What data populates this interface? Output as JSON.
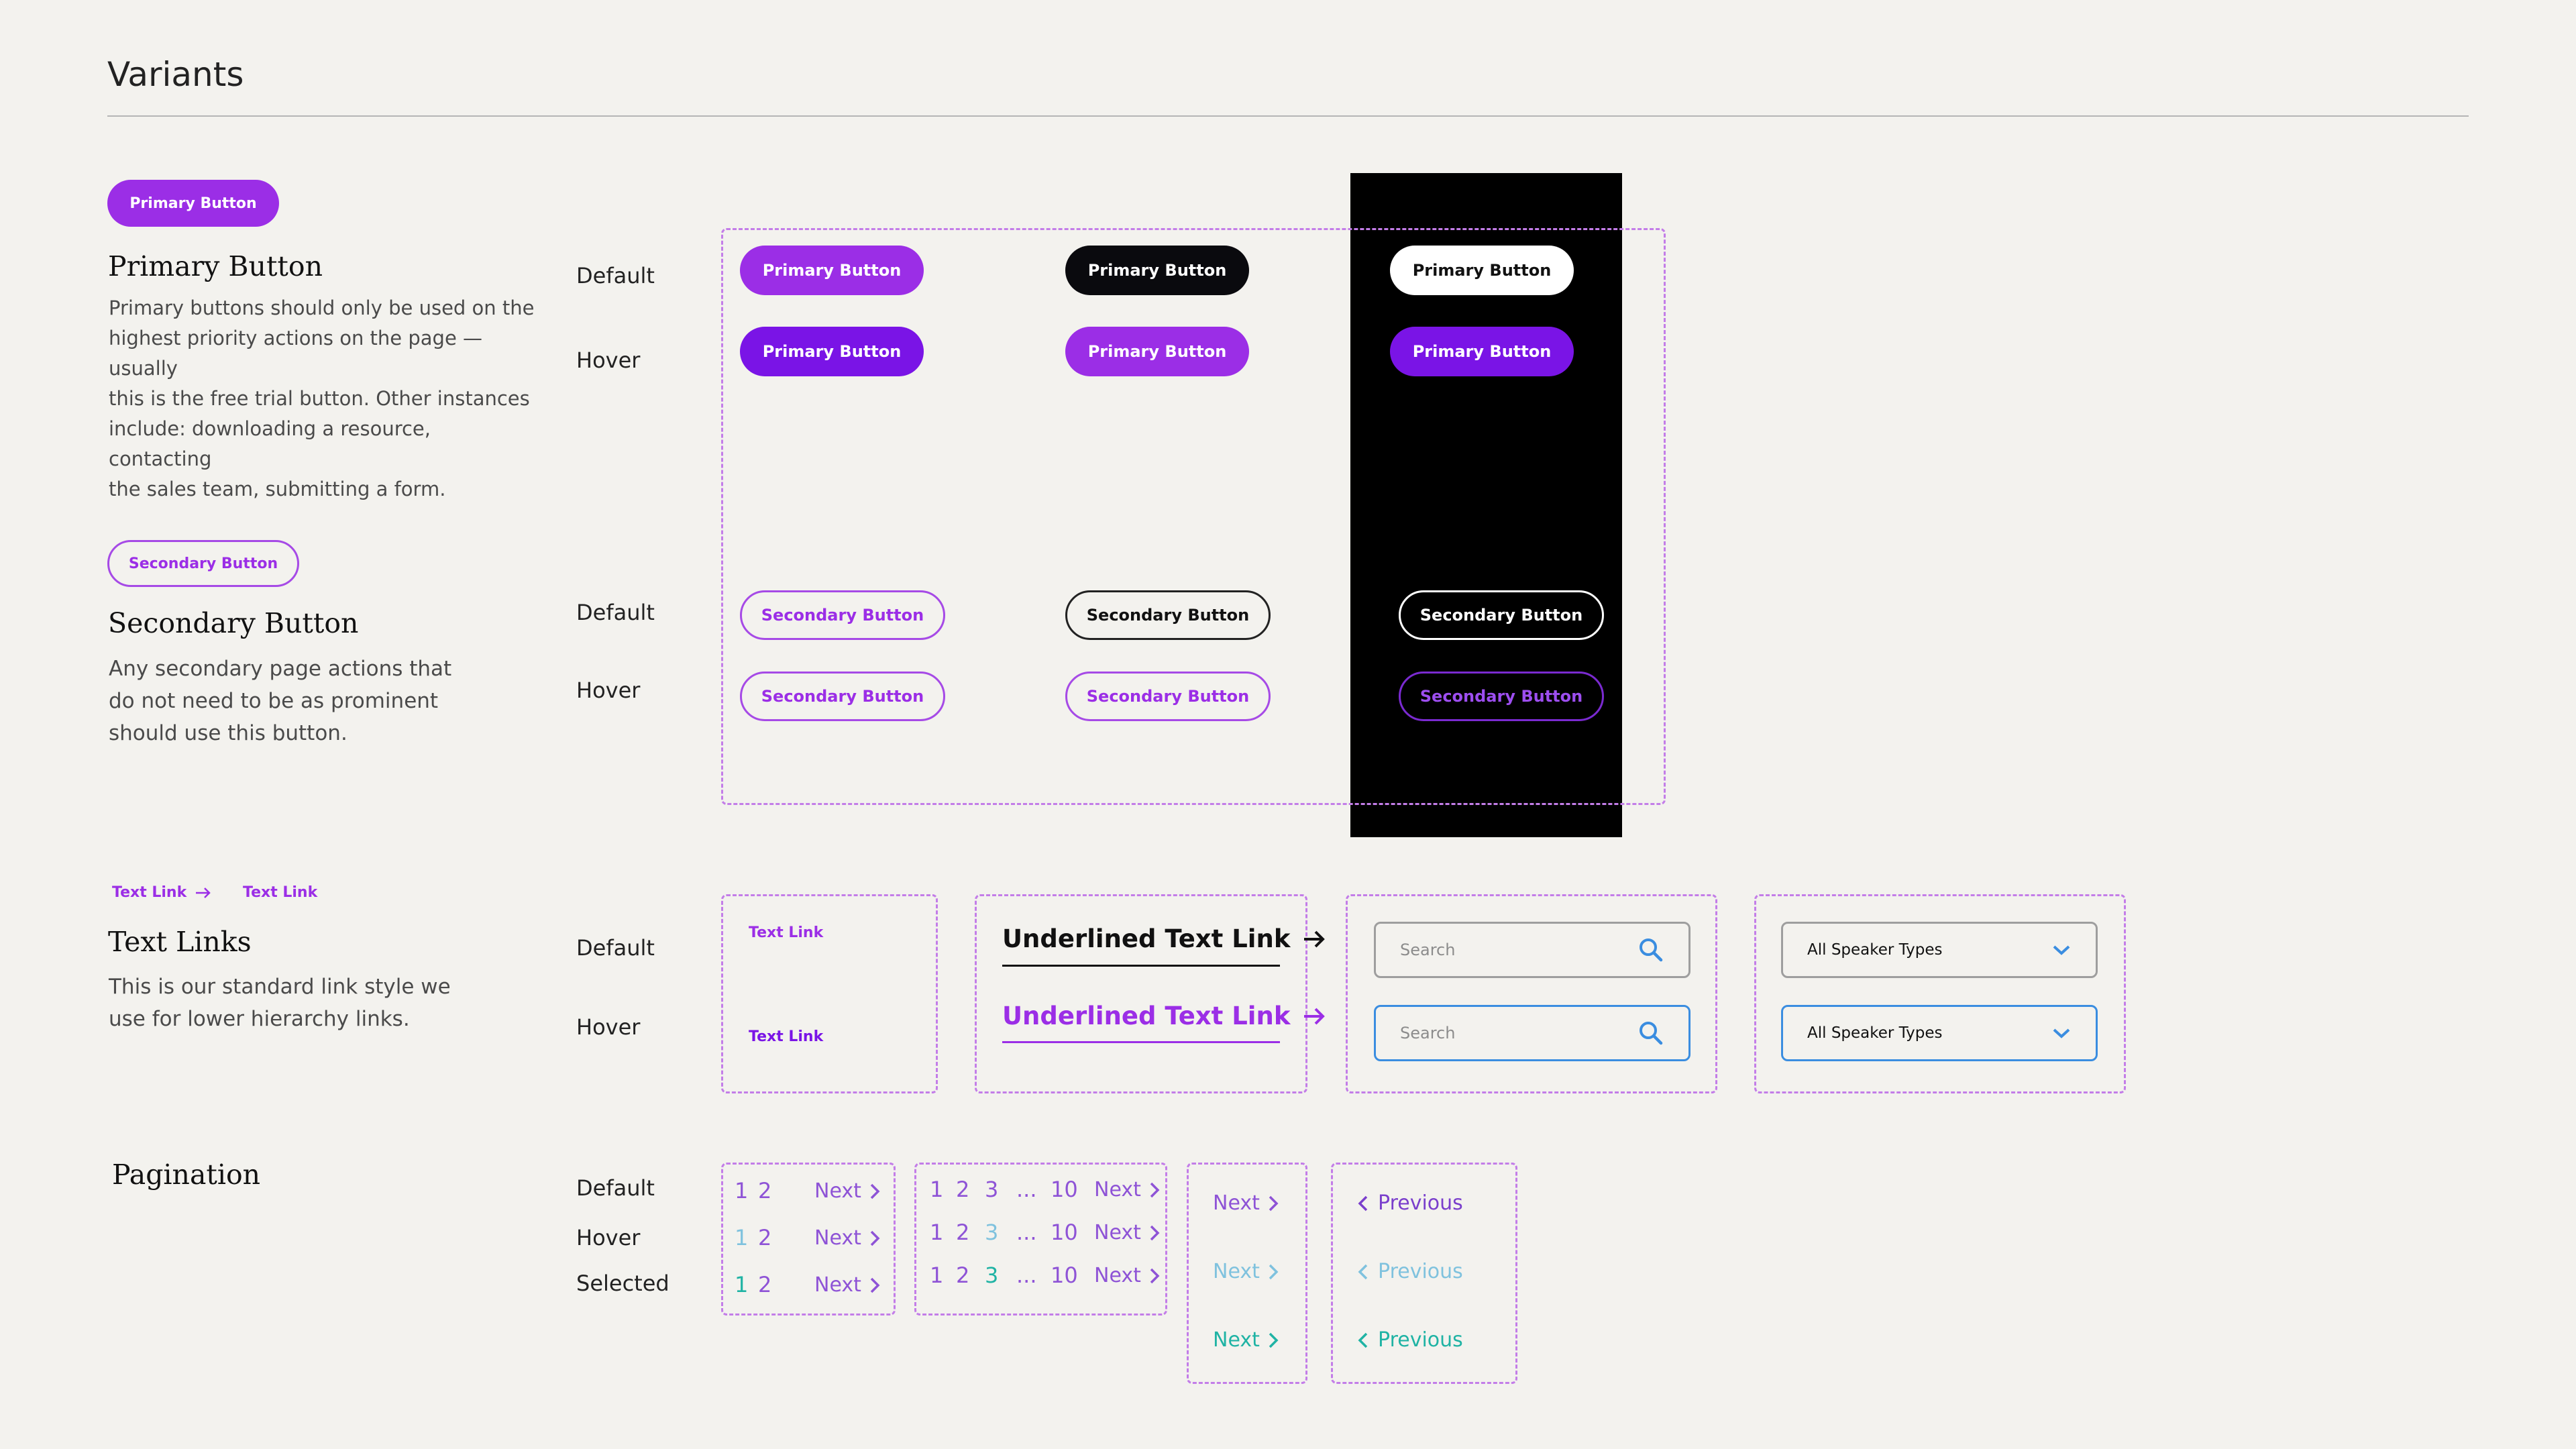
{
  "page": {
    "title": "Variants"
  },
  "states": {
    "default": "Default",
    "hover": "Hover",
    "selected": "Selected"
  },
  "primary": {
    "sample_label": "Primary Button",
    "heading": "Primary Button",
    "description": [
      "Primary buttons should only be used on the",
      "highest priority actions on the page — usually",
      "this is the free trial button. Other instances",
      "include: downloading a resource, contacting",
      "the sales team, submitting a form."
    ],
    "button_label": "Primary Button"
  },
  "secondary": {
    "sample_label": "Secondary Button",
    "heading": "Secondary Button",
    "description": [
      "Any secondary page actions that",
      "do not need to be as prominent",
      "should use this button."
    ],
    "button_label": "Secondary Button"
  },
  "text_links": {
    "sample_label_arrow": "Text Link",
    "sample_label_plain": "Text Link",
    "heading": "Text Links",
    "description": [
      "This is our standard link style we",
      "use for lower hierarchy links."
    ],
    "link_label": "Text Link",
    "underlined_label": "Underlined Text Link",
    "search_placeholder": "Search",
    "select_value": "All Speaker Types"
  },
  "pagination": {
    "heading": "Pagination",
    "page_1": "1",
    "page_2": "2",
    "page_3": "3",
    "ellipsis": "...",
    "page_10": "10",
    "next": "Next",
    "previous": "Previous"
  },
  "colors": {
    "background": "#f3f2ee",
    "brand_purple": "#9b2ee6",
    "hover_purple": "#7a14e6",
    "dashed_border": "#c37de8",
    "hover_blue": "#3a8de0",
    "pagination_default": "#8e53d6",
    "pagination_hover": "#7fc2de",
    "pagination_selected": "#1fb3a4"
  },
  "icons": [
    "arrow-right-icon",
    "search-icon",
    "chevron-down-icon",
    "chevron-right-icon",
    "chevron-left-icon"
  ]
}
